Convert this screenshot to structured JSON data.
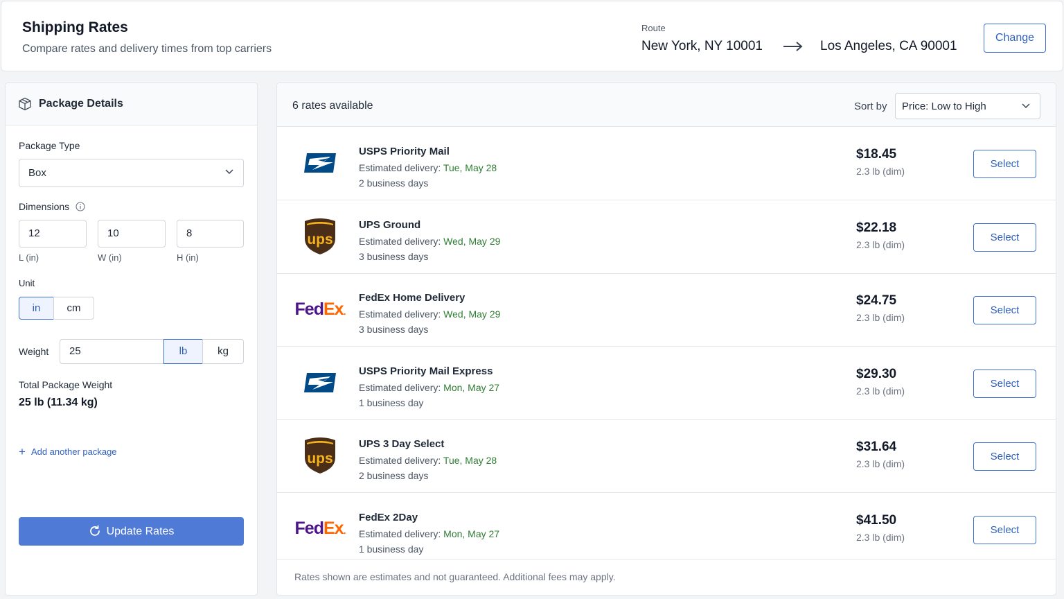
{
  "header": {
    "title": "Shipping Rates",
    "subtitle": "Compare rates and delivery times from top carriers",
    "route_label": "Route",
    "route_from": "New York, NY 10001",
    "route_to": "Los Angeles, CA 90001",
    "change_label": "Change"
  },
  "package": {
    "panel_title": "Package Details",
    "package_type_label": "Package Type",
    "package_type_value": "Box",
    "dimensions_label": "Dimensions",
    "length": "12",
    "width": "10",
    "height": "8",
    "length_label": "L (in)",
    "width_label": "W (in)",
    "height_label": "H (in)",
    "unit_label": "Unit",
    "unit_options": [
      "in",
      "cm"
    ],
    "unit_selected": "in",
    "weight_label": "Weight",
    "weight_value": "25",
    "weight_units": [
      "lb",
      "kg"
    ],
    "weight_unit_selected": "lb",
    "total_label": "Total Package Weight",
    "total_value": "25 lb (11.34 kg)",
    "add_package_label": "Add another package",
    "update_label": "Update Rates"
  },
  "results": {
    "count_label": "6 rates available",
    "sort_label": "Sort by",
    "sort_value": "Price: Low to High",
    "est_prefix": "Estimated delivery:",
    "select_label": "Select",
    "rates": [
      {
        "carrier": "usps",
        "service": "USPS Priority Mail",
        "date": "Tue, May 28",
        "days": "2 business days",
        "price": "$18.45",
        "weight": "2.3 lb (dim)"
      },
      {
        "carrier": "ups",
        "service": "UPS Ground",
        "date": "Wed, May 29",
        "days": "3 business days",
        "price": "$22.18",
        "weight": "2.3 lb (dim)"
      },
      {
        "carrier": "fedex",
        "service": "FedEx Home Delivery",
        "date": "Wed, May 29",
        "days": "3 business days",
        "price": "$24.75",
        "weight": "2.3 lb (dim)"
      },
      {
        "carrier": "usps",
        "service": "USPS Priority Mail Express",
        "date": "Mon, May 27",
        "days": "1 business day",
        "price": "$29.30",
        "weight": "2.3 lb (dim)"
      },
      {
        "carrier": "ups",
        "service": "UPS 3 Day Select",
        "date": "Tue, May 28",
        "days": "2 business days",
        "price": "$31.64",
        "weight": "2.3 lb (dim)"
      },
      {
        "carrier": "fedex",
        "service": "FedEx 2Day",
        "date": "Mon, May 27",
        "days": "1 business day",
        "price": "$41.50",
        "weight": "2.3 lb (dim)"
      }
    ],
    "footnote": "Rates shown are estimates and not guaranteed. Additional fees may apply."
  },
  "logos": {
    "ups_text": "ups",
    "fedex_fe": "Fed",
    "fedex_ex": "Ex"
  },
  "colors": {
    "accent": "#3b6fd4",
    "primary_button": "#4f7ad6",
    "delivery_date": "#2e7d32",
    "usps_blue": "#004b87",
    "ups_brown": "#4b2e18",
    "ups_gold": "#f5b21a",
    "fedex_purple": "#4d148c",
    "fedex_orange": "#ff6600"
  }
}
